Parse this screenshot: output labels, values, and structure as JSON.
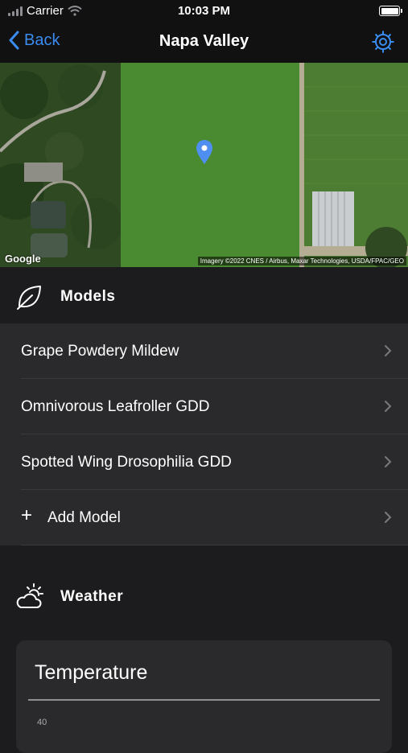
{
  "status_bar": {
    "carrier": "Carrier",
    "time": "10:03 PM"
  },
  "nav": {
    "back_label": "Back",
    "title": "Napa Valley"
  },
  "map": {
    "logo": "Google",
    "attribution": "Imagery ©2022 CNES / Airbus, Maxar Technologies, USDA/FPAC/GEO"
  },
  "models": {
    "header": "Models",
    "items": [
      {
        "label": "Grape Powdery Mildew"
      },
      {
        "label": "Omnivorous Leafroller GDD"
      },
      {
        "label": "Spotted Wing Drosophilia GDD"
      }
    ],
    "add_label": "Add Model",
    "add_symbol": "+"
  },
  "weather": {
    "header": "Weather",
    "card_title": "Temperature",
    "first_tick": "40"
  },
  "colors": {
    "accent": "#3a8cf0",
    "background": "#1c1c1e",
    "list_bg": "#2a2a2c"
  }
}
